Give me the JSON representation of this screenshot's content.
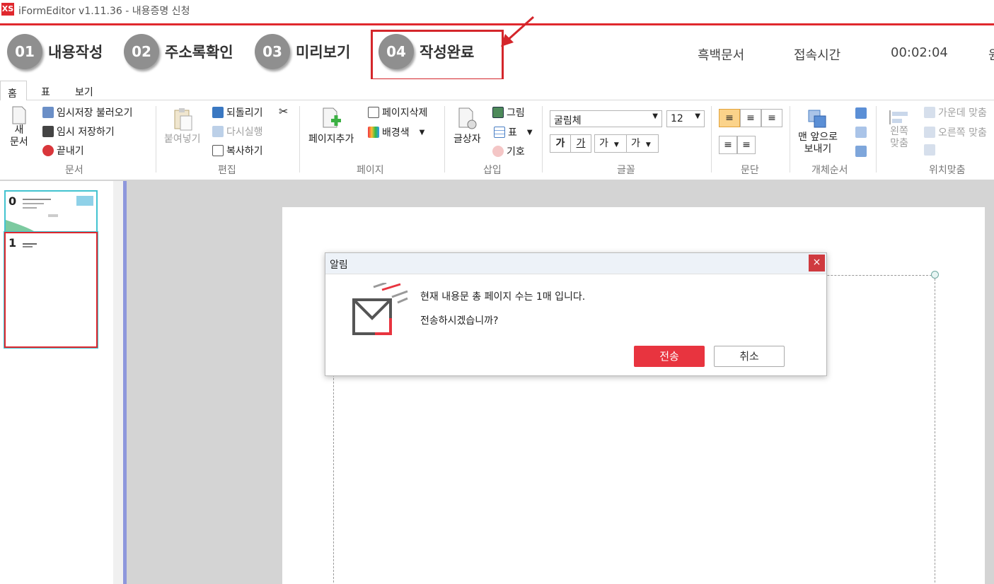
{
  "window": {
    "title": "iFormEditor v1.11.36 - 내용증명 신청",
    "icon_text": "XS"
  },
  "steps": [
    {
      "num": "01",
      "label": "내용작성"
    },
    {
      "num": "02",
      "label": "주소록확인"
    },
    {
      "num": "03",
      "label": "미리보기"
    },
    {
      "num": "04",
      "label": "작성완료"
    }
  ],
  "header_right": {
    "mode": "흑백문서",
    "time_label": "접속시간",
    "time": "00:02:04",
    "partial": "원"
  },
  "tabs": [
    "홈",
    "표",
    "보기"
  ],
  "ribbon": {
    "doc": {
      "new": "새\n문서",
      "load_temp": "임시저장 불러오기",
      "save_temp": "임시 저장하기",
      "exit": "끝내기",
      "label": "문서"
    },
    "edit": {
      "paste": "붙여넣기",
      "undo": "되돌리기",
      "redo": "다시실행",
      "copy": "복사하기",
      "label": "편집"
    },
    "page": {
      "add": "페이지추가",
      "delete": "페이지삭제",
      "bg": "배경색",
      "label": "페이지"
    },
    "insert": {
      "textbox": "글상자",
      "image": "그림",
      "table": "표",
      "symbol": "기호",
      "label": "삽입"
    },
    "font": {
      "family": "굴림체",
      "size": "12",
      "bold": "가",
      "underline": "가",
      "color1": "가",
      "color2": "가",
      "label": "글꼴"
    },
    "para": {
      "label": "문단"
    },
    "order": {
      "front": "맨 앞으로\n보내기",
      "label": "개체순서"
    },
    "align": {
      "left": "왼쪽\n맞춤",
      "center": "가운데 맞춤",
      "right": "오른쪽 맞춤",
      "label": "위치맞춤"
    }
  },
  "thumbnails": [
    "0",
    "1"
  ],
  "dialog": {
    "title": "알림",
    "close": "×",
    "message1": "현재 내용문 총 페이지 수는 1매 입니다.",
    "message2": "전송하시겠습니까?",
    "send": "전송",
    "cancel": "취소"
  },
  "colors": {
    "accent": "#e0282e",
    "send_button": "#e8343f",
    "step_circle": "#8f8f8f"
  }
}
